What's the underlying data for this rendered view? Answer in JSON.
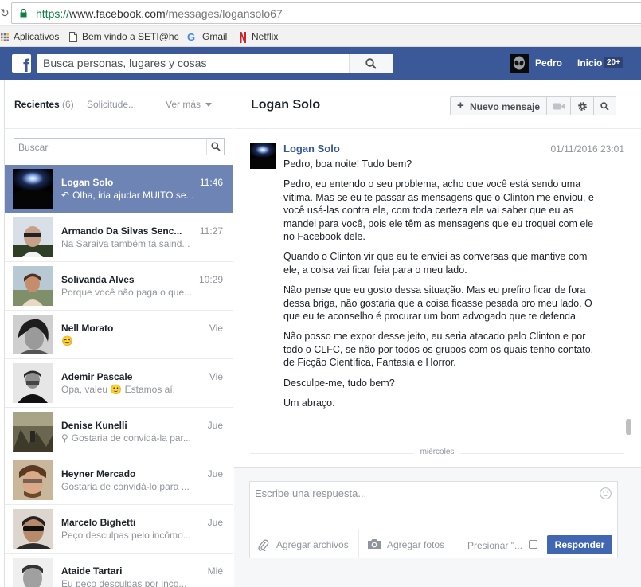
{
  "browser": {
    "url_scheme": "https://",
    "url_host": "www.facebook.com",
    "url_path": "/messages/logansolo67",
    "bookmarks": [
      {
        "label": "Aplicativos",
        "icon": "apps-grid-icon"
      },
      {
        "label": "Bem vindo a SETI@hc",
        "icon": "page-icon"
      },
      {
        "label": "Gmail",
        "icon": "google-icon"
      },
      {
        "label": "Netflix",
        "icon": "netflix-icon"
      }
    ]
  },
  "fbbar": {
    "search_placeholder": "Busca personas, lugares y cosas",
    "user_name": "Pedro",
    "home_label": "Inicio",
    "home_badge": "20+"
  },
  "sidebar": {
    "tab_recent": "Recientes",
    "tab_recent_count": "(6)",
    "tab_requests": "Solicitude...",
    "tab_more": "Ver más",
    "search_placeholder": "Buscar",
    "threads": [
      {
        "name": "Logan Solo",
        "snippet": "Olha, iria ajudar MUITO se...",
        "time": "11:46",
        "active": true,
        "reply_icon": true
      },
      {
        "name": "Armando Da Silvas Senc...",
        "snippet": "Na Saraiva também tá saind...",
        "time": "11:27"
      },
      {
        "name": "Solivanda Alves",
        "snippet": "Porque você não paga o que...",
        "time": "10:29"
      },
      {
        "name": "Nell Morato",
        "snippet": "😊",
        "time": "Vie"
      },
      {
        "name": "Ademir Pascale",
        "snippet": "Opa, valeu 🙂 Estamos aí.",
        "time": "Vie"
      },
      {
        "name": "Denise Kunelli",
        "snippet": "Gostaria de convidá-la par...",
        "time": "Jue",
        "attach_icon": true
      },
      {
        "name": "Heyner Mercado",
        "snippet": "Gostaria de convidá-lo para ...",
        "time": "Jue"
      },
      {
        "name": "Marcelo Bighetti",
        "snippet": "Peço desculpas pelo incômo...",
        "time": "Jue"
      },
      {
        "name": "Ataide Tartari",
        "snippet": "Eu peço desculpas por inco...",
        "time": "Mié"
      }
    ]
  },
  "conversation": {
    "title": "Logan Solo",
    "new_message_label": "Nuevo mensaje",
    "author": "Logan Solo",
    "date": "01/11/2016 23:01",
    "paragraphs": [
      "Pedro, boa noite! Tudo bem?",
      "Pedro, eu entendo o seu problema, acho que você está sendo uma vítima. Mas se eu te passar as mensagens que o Clinton me enviou, e você usá-las contra ele, com toda certeza ele vai saber que eu as mandei para você, pois ele têm as mensagens que eu troquei com ele no Facebook dele.",
      "Quando o Clinton vir que eu te enviei as conversas que mantive com ele, a coisa vai ficar feia para o meu lado.",
      "Não pense que eu gosto dessa situação. Mas eu prefiro ficar de fora dessa briga, não gostaria que a coisa ficasse pesada pro meu lado. O que eu te aconselho é procurar um bom advogado que te defenda.",
      "Não posso me expor desse jeito, eu seria atacado pelo Clinton e por todo o CLFC, se não por todos os grupos com os quais tenho contato, de Ficção Científica, Fantasia e Horror.",
      "Desculpe-me, tudo bem?",
      "Um abraço."
    ],
    "day_separator": "miércoles"
  },
  "composer": {
    "placeholder": "Escribe una respuesta...",
    "attach_files": "Agregar archivos",
    "add_photos": "Agregar fotos",
    "press_enter": "Presionar \"...",
    "reply_button": "Responder"
  }
}
